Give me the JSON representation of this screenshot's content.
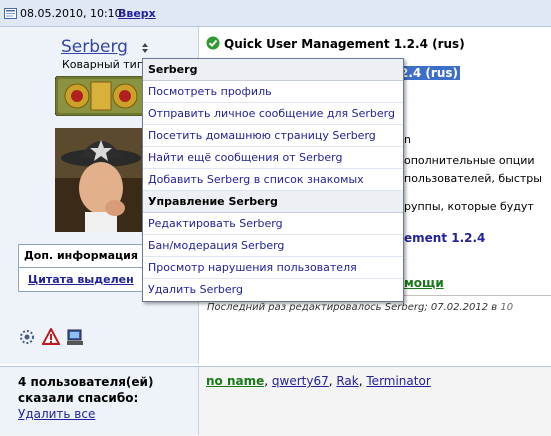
{
  "post": {
    "date": "08.05.2010, 10:10",
    "top_link": "Вверх",
    "title": "Quick User Management 1.2.4 (rus)",
    "highlight": "2.4 (rus)",
    "body_lines": [
      "n",
      "ополнительные опции",
      "пользователей, быстры",
      "руппы, которые будут"
    ],
    "body_heading": "ement 1.2.4",
    "help_link": "мощи",
    "edited_text": "Последний раз редактировалось Serberg; 07.02.2012 в",
    "edited_time": "10"
  },
  "user": {
    "name": "Serberg",
    "title": "Коварный тип",
    "additional_info": "Доп. информация",
    "quote_label": "Цитата выделен"
  },
  "menu": {
    "title": "Serberg",
    "items": [
      "Посмотреть профиль",
      "Отправить личное сообщение для Serberg",
      "Посетить домашнюю страницу Serberg",
      "Найти ещё сообщения от Serberg",
      "Добавить Serberg в список знакомых"
    ],
    "admin_title": "Управление Serberg",
    "admin_items": [
      "Редактировать Serberg",
      "Бан/модерация Serberg",
      "Просмотр нарушения пользователя",
      "Удалить Serberg"
    ]
  },
  "thanks": {
    "count_text": "4 пользователя(ей) сказали спасибо:",
    "remove_all": "Удалить все",
    "names": [
      "no name",
      "qwerty67",
      "Rak",
      "Terminator"
    ]
  },
  "icons": [
    "post-icon",
    "check-icon",
    "rank-badge",
    "avatar-image",
    "gear-tool-icon",
    "warning-icon",
    "computer-icon",
    "dropdown-caret-icon"
  ],
  "colors": {
    "link": "#22229c",
    "highlight": "#3e6fc8",
    "green": "#1a7a1a",
    "header_bg": "#dfe8f4"
  }
}
